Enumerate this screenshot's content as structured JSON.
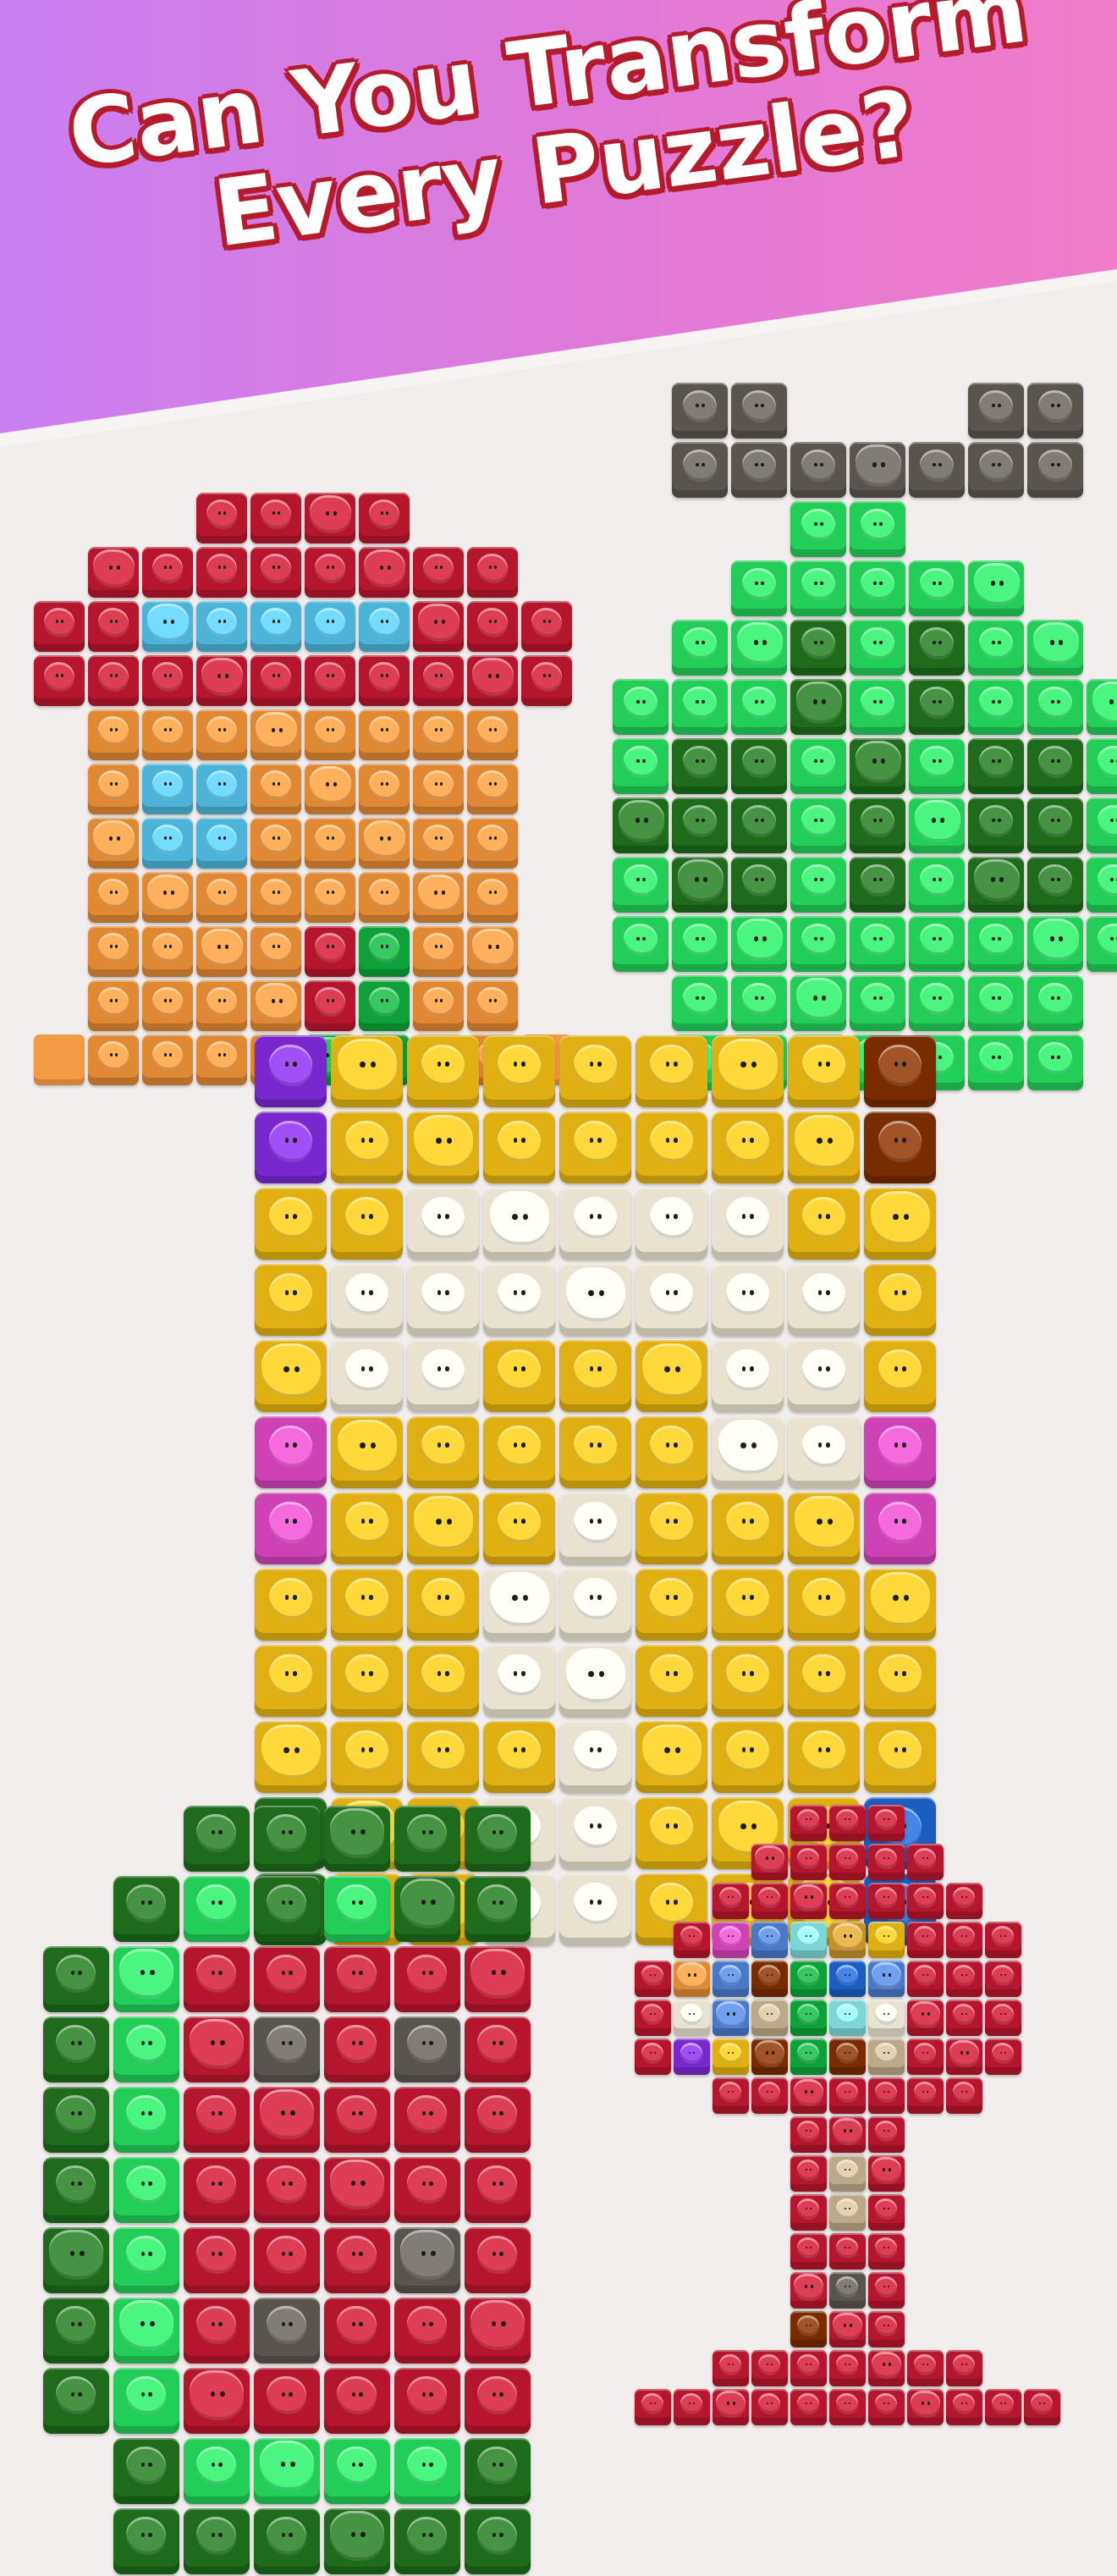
{
  "banner": {
    "title_line1": "Can You Transform",
    "title_line2": "Every Puzzle?"
  },
  "palette": {
    "R": "#c8283f",
    "O": "#f39a45",
    "B": "#5ec6ea",
    "G": "#20b34b",
    "g": "#35e06a",
    "K": "#2f7d2d",
    "D": "#6b6660",
    "Y": "#f2c224",
    "y": "#ffdd22",
    "W": "#fbf4e2",
    "P": "#8a3ae0",
    "M": "#e054c7",
    "N": "#8a3e12",
    "L": "#2e6fd2",
    "T": "#cdbb99",
    "C": "#8fe8e8",
    "S": "#5a8ad8",
    "E": "#d6a43a"
  },
  "puzzles": [
    {
      "name": "house-puzzle",
      "grid": [
        "...RRRR...",
        ".RRRRRRRR.",
        "RRBBBBBRRR",
        "RRRRRRRRRR",
        ".OOOOOOOO.",
        ".OBBOOOOO.",
        ".OBBOOOOO.",
        ".OOOOOOOO.",
        ".OOOORGOO.",
        ".OOOORGOO.",
        "oOOOOGGOOo"
      ]
    },
    {
      "name": "apple-puzzle",
      "grid": [
        ".DD...DD.",
        ".DDDDDDD.",
        "...gg....",
        "..ggggg..",
        ".ggKgKgg.",
        "gggKgKggg",
        "gKKgKgKKg",
        "KKKgKgKKg",
        "gKKgKgKKg",
        "ggggggggg",
        ".ggggggg.",
        ".ggggggg."
      ]
    },
    {
      "name": "cheese-puzzle",
      "grid": [
        "PYYYYYYYN",
        "PYYYYYYYN",
        "YYWWWWWYY",
        "YWWWWWWWY",
        "YWWYYYWWY",
        "MYYYYYWWM",
        "MYYYWYYYM",
        "YYYWWYYYY",
        "YYYWWYYYY",
        "YYYYWYYYY",
        "KYYWWYYYL",
        "KYYWWYYYL"
      ]
    },
    {
      "name": "watermelon-puzzle",
      "grid": [
        "..KKKKK",
        ".KgKgKK",
        "KgRRRRR",
        "KgRDRDR",
        "KgRRRRR",
        "KgRRRRR",
        "KgRRRDR",
        "KgRDRRR",
        "KgRRRRR",
        ".KggggK",
        ".KKKKKK"
      ]
    },
    {
      "name": "tree-puzzle",
      "grid": [
        "....RRR....",
        "...RRRRR...",
        "..RRRRRRR..",
        ".RMSCEYRRR.",
        "ROSNGLSRRR.",
        "RWSTGCWRRR.",
        "RPYNGNTRRR.",
        "..RRRRRRR..",
        "....RRR....",
        "....RTR....",
        "....RTR....",
        "....RRR....",
        "....RDR....",
        "....NRR....",
        "..RRRRRRR..",
        "RRRRRRRRRRR"
      ]
    }
  ]
}
